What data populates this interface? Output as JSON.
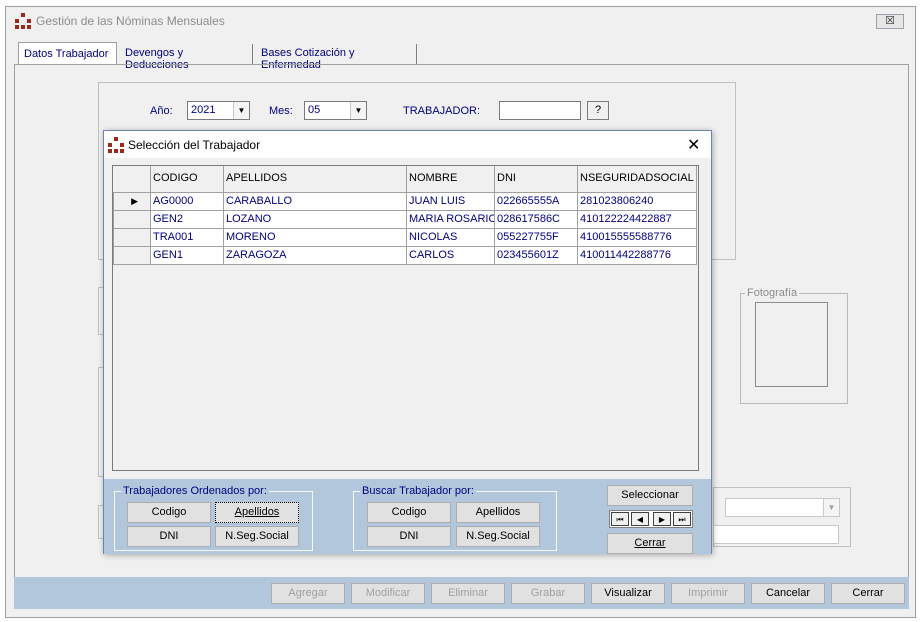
{
  "window": {
    "title": "Gestión de las Nóminas Mensuales",
    "close_label": "☒"
  },
  "tabs": [
    {
      "label": "Datos Trabajador"
    },
    {
      "label": "Devengos y Deducciones"
    },
    {
      "label": "Bases Cotización y Enfermedad"
    }
  ],
  "form": {
    "year_label": "Año:",
    "year_value": "2021",
    "month_label": "Mes:",
    "month_value": "05",
    "worker_label": "TRABAJADOR:",
    "worker_value": "",
    "lookup_label": "?",
    "photo_label": "Fotografía"
  },
  "dialog": {
    "title": "Selección del Trabajador",
    "close_label": "✕",
    "columns": [
      "CODIGO",
      "APELLIDOS",
      "NOMBRE",
      "DNI",
      "NSEGURIDADSOCIAL"
    ],
    "rows": [
      {
        "indicator": "▶",
        "codigo": "AG0000",
        "apellidos": "CARABALLO",
        "nombre": "JUAN LUIS",
        "dni": "022665555A",
        "nss": "281023806240"
      },
      {
        "indicator": "",
        "codigo": "GEN2",
        "apellidos": "LOZANO",
        "nombre": "MARIA ROSARIO",
        "dni": "028617586C",
        "nss": "410122224422887"
      },
      {
        "indicator": "",
        "codigo": "TRA001",
        "apellidos": "MORENO",
        "nombre": "NICOLAS",
        "dni": "055227755F",
        "nss": "410015555588776"
      },
      {
        "indicator": "",
        "codigo": "GEN1",
        "apellidos": "ZARAGOZA",
        "nombre": "CARLOS",
        "dni": "023455601Z",
        "nss": "410011442288776"
      }
    ],
    "order_group": {
      "legend": "Trabajadores Ordenados por:",
      "buttons": [
        "Codigo",
        "Apellidos",
        "DNI",
        "N.Seg.Social"
      ]
    },
    "search_group": {
      "legend": "Buscar Trabajador  por:",
      "buttons": [
        "Codigo",
        "Apellidos",
        "DNI",
        "N.Seg.Social"
      ]
    },
    "select_label": "Seleccionar",
    "close_button_label": "Cerrar",
    "nav": [
      "⏮",
      "◀",
      "▶",
      "⏭"
    ]
  },
  "toolbar": {
    "buttons": [
      {
        "label": "Agregar",
        "enabled": false
      },
      {
        "label": "Modificar",
        "enabled": false
      },
      {
        "label": "Eliminar",
        "enabled": false
      },
      {
        "label": "Grabar",
        "enabled": false
      },
      {
        "label": "Visualizar",
        "enabled": true
      },
      {
        "label": "Imprimir",
        "enabled": false
      },
      {
        "label": "Cancelar",
        "enabled": true
      },
      {
        "label": "Cerrar",
        "enabled": true
      }
    ]
  }
}
